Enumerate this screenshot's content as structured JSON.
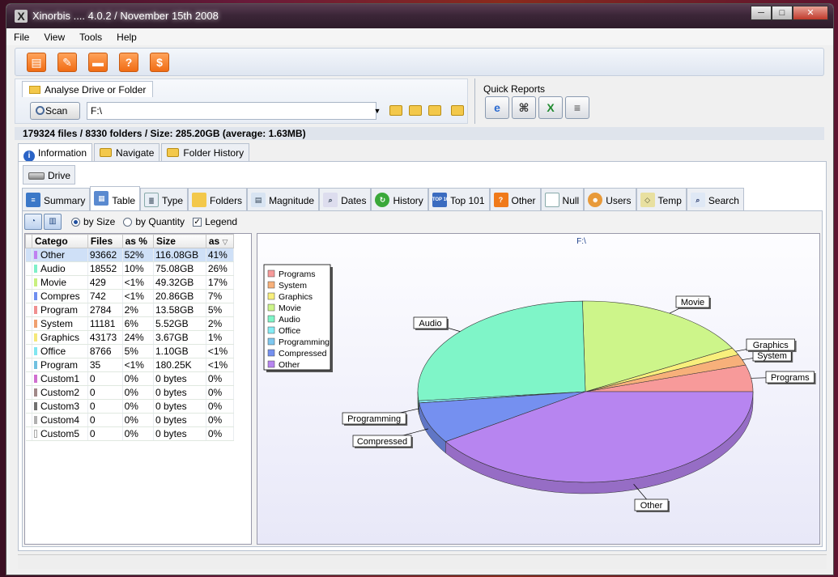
{
  "window": {
    "title": "Xinorbis .... 4.0.2 / November 15th 2008"
  },
  "menu": [
    "File",
    "View",
    "Tools",
    "Help"
  ],
  "toolbar": {
    "icons": [
      "save-icon",
      "wrench-icon",
      "folder-icon",
      "help-icon",
      "dollar-icon"
    ],
    "help_glyph": "?",
    "dollar_glyph": "$"
  },
  "analyse": {
    "tab_label": "Analyse Drive or Folder",
    "scan_label": "Scan",
    "path_value": "F:\\"
  },
  "quick_reports": {
    "title": "Quick Reports"
  },
  "summary": {
    "files": "179324 files",
    "sep1": "/",
    "folders": "8330 folders",
    "sep2": "/",
    "size": "Size: 285.20GB (average: 1.63MB)"
  },
  "main_tabs": [
    "Information",
    "Navigate",
    "Folder History"
  ],
  "drive_tab": "Drive",
  "sub_tabs": [
    "Summary",
    "Table",
    "Type",
    "Folders",
    "Magnitude",
    "Dates",
    "History",
    "Top 101",
    "Other",
    "Null",
    "Users",
    "Temp",
    "Search"
  ],
  "sub_tab_top_label": "TOP 101",
  "options": {
    "by_size": "by Size",
    "by_quantity": "by Quantity",
    "legend": "Legend",
    "check_glyph": "✓"
  },
  "table": {
    "headers": [
      "Catego",
      "Files",
      "as %",
      "Size",
      "as"
    ],
    "rows": [
      {
        "name": "Other",
        "files": "93662",
        "pct": "52%",
        "size": "116.08GB",
        "size_pct": "41%",
        "color": "#c080f0"
      },
      {
        "name": "Audio",
        "files": "18552",
        "pct": "10%",
        "size": "75.08GB",
        "size_pct": "26%",
        "color": "#7ff0c8"
      },
      {
        "name": "Movie",
        "files": "429",
        "pct": "<1%",
        "size": "49.32GB",
        "size_pct": "17%",
        "color": "#c8f07f"
      },
      {
        "name": "Compres",
        "files": "742",
        "pct": "<1%",
        "size": "20.86GB",
        "size_pct": "7%",
        "color": "#6f8ef0"
      },
      {
        "name": "Program",
        "files": "2784",
        "pct": "2%",
        "size": "13.58GB",
        "size_pct": "5%",
        "color": "#f08f8f"
      },
      {
        "name": "System",
        "files": "11181",
        "pct": "6%",
        "size": "5.52GB",
        "size_pct": "2%",
        "color": "#f0a070"
      },
      {
        "name": "Graphics",
        "files": "43173",
        "pct": "24%",
        "size": "3.67GB",
        "size_pct": "1%",
        "color": "#f5e87a"
      },
      {
        "name": "Office",
        "files": "8766",
        "pct": "5%",
        "size": "1.10GB",
        "size_pct": "<1%",
        "color": "#80e6f0"
      },
      {
        "name": "Program",
        "files": "35",
        "pct": "<1%",
        "size": "180.25K",
        "size_pct": "<1%",
        "color": "#70c0e0"
      },
      {
        "name": "Custom1",
        "files": "0",
        "pct": "0%",
        "size": "0 bytes",
        "size_pct": "0%",
        "color": "#d070d0"
      },
      {
        "name": "Custom2",
        "files": "0",
        "pct": "0%",
        "size": "0 bytes",
        "size_pct": "0%",
        "color": "#a08888"
      },
      {
        "name": "Custom3",
        "files": "0",
        "pct": "0%",
        "size": "0 bytes",
        "size_pct": "0%",
        "color": "#707070"
      },
      {
        "name": "Custom4",
        "files": "0",
        "pct": "0%",
        "size": "0 bytes",
        "size_pct": "0%",
        "color": "#b0b0b0"
      },
      {
        "name": "Custom5",
        "files": "0",
        "pct": "0%",
        "size": "0 bytes",
        "size_pct": "0%",
        "color": "#ffffff"
      }
    ]
  },
  "chart_data": {
    "type": "pie",
    "title": "F:\\",
    "legend_position": "top-left",
    "categories": [
      "Programs",
      "System",
      "Graphics",
      "Movie",
      "Audio",
      "Office",
      "Programming",
      "Compressed",
      "Other"
    ],
    "values": [
      13.58,
      5.52,
      3.67,
      49.32,
      75.08,
      1.1,
      0.00018,
      20.86,
      116.08
    ],
    "unit": "GB",
    "colors": [
      "#f79a9a",
      "#f7b07a",
      "#f8ef7c",
      "#cdf58a",
      "#7ff5c8",
      "#85ecf5",
      "#7ec8f0",
      "#7590f0",
      "#b785f0"
    ]
  }
}
